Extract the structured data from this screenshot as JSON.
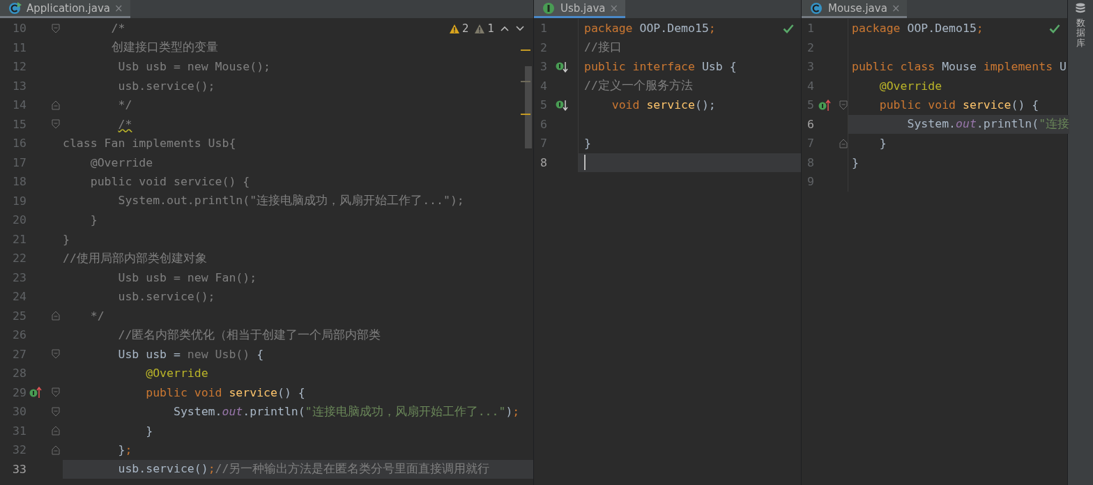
{
  "panes": [
    {
      "tab": {
        "label": "Application.java",
        "kind": "class",
        "runnable": true,
        "close": "×"
      },
      "focused": false,
      "inspections": {
        "warnings": "2",
        "weak_warnings": "1"
      },
      "lines": [
        {
          "number": "10",
          "current": false,
          "fold": {
            "kind": "start"
          },
          "tokens": [
            {
              "text": "       /*",
              "kind": "comment"
            }
          ]
        },
        {
          "number": "11",
          "current": false,
          "tokens": [
            {
              "text": "       创建接口类型的变量",
              "kind": "comment"
            }
          ]
        },
        {
          "number": "12",
          "current": false,
          "tokens": [
            {
              "text": "        Usb usb = new Mouse();",
              "kind": "comment"
            }
          ]
        },
        {
          "number": "13",
          "current": false,
          "tokens": [
            {
              "text": "        usb.service();",
              "kind": "comment"
            }
          ]
        },
        {
          "number": "14",
          "current": false,
          "fold": {
            "kind": "end"
          },
          "tokens": [
            {
              "text": "        */",
              "kind": "comment"
            }
          ]
        },
        {
          "number": "15",
          "current": false,
          "fold": {
            "kind": "start"
          },
          "tokens": [
            {
              "text": "        /*",
              "kind": "flagged"
            }
          ]
        },
        {
          "number": "16",
          "current": false,
          "tokens": [
            {
              "text": "class Fan implements Usb{",
              "kind": "comment"
            }
          ]
        },
        {
          "number": "17",
          "current": false,
          "tokens": [
            {
              "text": "    @Override",
              "kind": "comment"
            }
          ]
        },
        {
          "number": "18",
          "current": false,
          "tokens": [
            {
              "text": "    public void service() {",
              "kind": "comment"
            }
          ]
        },
        {
          "number": "19",
          "current": false,
          "tokens": [
            {
              "text": "        System.out.println(\"连接电脑成功，风扇开始工作了...\");",
              "kind": "comment"
            }
          ]
        },
        {
          "number": "20",
          "current": false,
          "tokens": [
            {
              "text": "    }",
              "kind": "comment"
            }
          ]
        },
        {
          "number": "21",
          "current": false,
          "tokens": [
            {
              "text": "}",
              "kind": "comment"
            }
          ]
        },
        {
          "number": "22",
          "current": false,
          "tokens": [
            {
              "text": "//使用局部内部类创建对象",
              "kind": "comment"
            }
          ]
        },
        {
          "number": "23",
          "current": false,
          "tokens": [
            {
              "text": "        Usb usb = new Fan();",
              "kind": "comment"
            }
          ]
        },
        {
          "number": "24",
          "current": false,
          "tokens": [
            {
              "text": "        usb.service();",
              "kind": "comment"
            }
          ]
        },
        {
          "number": "25",
          "current": false,
          "fold": {
            "kind": "end"
          },
          "tokens": [
            {
              "text": "    */",
              "kind": "comment"
            }
          ]
        },
        {
          "number": "26",
          "current": false,
          "tokens": [
            {
              "text": "        //匿名内部类优化（相当于创建了一个局部内部类",
              "kind": "comment"
            }
          ]
        },
        {
          "number": "27",
          "current": false,
          "fold": {
            "kind": "start"
          },
          "tokens": [
            {
              "text": "        Usb usb = ",
              "kind": "plain"
            },
            {
              "text": "new Usb()",
              "kind": "unused"
            },
            {
              "text": " {",
              "kind": "plain"
            }
          ]
        },
        {
          "number": "28",
          "current": false,
          "tokens": [
            {
              "text": "            @Override",
              "kind": "annotation"
            }
          ]
        },
        {
          "number": "29",
          "current": false,
          "fold": {
            "kind": "start"
          },
          "marker": {
            "kind": "overrides"
          },
          "tokens": [
            {
              "text": "            public void ",
              "kind": "keyword"
            },
            {
              "text": "service",
              "kind": "method"
            },
            {
              "text": "() {",
              "kind": "plain"
            }
          ]
        },
        {
          "number": "30",
          "current": false,
          "fold": {
            "kind": "start"
          },
          "tokens": [
            {
              "text": "                System.",
              "kind": "plain"
            },
            {
              "text": "out",
              "kind": "static"
            },
            {
              "text": ".println(",
              "kind": "plain"
            },
            {
              "text": "\"连接电脑成功，风扇开始工作了...\"",
              "kind": "string"
            },
            {
              "text": ")",
              "kind": "plain"
            },
            {
              "text": ";",
              "kind": "keyword"
            }
          ]
        },
        {
          "number": "31",
          "current": false,
          "fold": {
            "kind": "end"
          },
          "tokens": [
            {
              "text": "            }",
              "kind": "plain"
            }
          ]
        },
        {
          "number": "32",
          "current": false,
          "fold": {
            "kind": "end"
          },
          "tokens": [
            {
              "text": "        }",
              "kind": "plain"
            },
            {
              "text": ";",
              "kind": "keyword"
            }
          ]
        },
        {
          "number": "33",
          "current": true,
          "tokens": [
            {
              "text": "        usb.service()",
              "kind": "plain"
            },
            {
              "text": ";",
              "kind": "keyword"
            },
            {
              "text": "//另一种输出方法是在匿名类分号里面直接调用就行",
              "kind": "comment"
            }
          ]
        }
      ]
    },
    {
      "tab": {
        "label": "Usb.java",
        "kind": "interface",
        "runnable": false,
        "close": "×"
      },
      "focused": true,
      "check": true,
      "lines": [
        {
          "number": "1",
          "current": false,
          "tokens": [
            {
              "text": "package",
              "kind": "keyword"
            },
            {
              "text": " OOP.Demo15",
              "kind": "plain"
            },
            {
              "text": ";",
              "kind": "keyword"
            }
          ]
        },
        {
          "number": "2",
          "current": false,
          "tokens": [
            {
              "text": "//接口",
              "kind": "comment"
            }
          ]
        },
        {
          "number": "3",
          "current": false,
          "marker": {
            "kind": "implemented"
          },
          "tokens": [
            {
              "text": "public interface ",
              "kind": "keyword"
            },
            {
              "text": "Usb {",
              "kind": "plain"
            }
          ]
        },
        {
          "number": "4",
          "current": false,
          "tokens": [
            {
              "text": "//定义一个服务方法",
              "kind": "comment"
            }
          ]
        },
        {
          "number": "5",
          "current": false,
          "marker": {
            "kind": "implemented"
          },
          "tokens": [
            {
              "text": "    void ",
              "kind": "keyword"
            },
            {
              "text": "service",
              "kind": "method"
            },
            {
              "text": "();",
              "kind": "plain"
            }
          ]
        },
        {
          "number": "6",
          "current": false
        },
        {
          "number": "7",
          "current": false,
          "tokens": [
            {
              "text": "}",
              "kind": "plain"
            }
          ]
        },
        {
          "number": "8",
          "current": true
        }
      ]
    },
    {
      "tab": {
        "label": "Mouse.java",
        "kind": "class",
        "runnable": false,
        "close": "×"
      },
      "focused": false,
      "check": true,
      "lines": [
        {
          "number": "1",
          "current": false,
          "tokens": [
            {
              "text": "package",
              "kind": "keyword"
            },
            {
              "text": " OOP.Demo15",
              "kind": "plain"
            },
            {
              "text": ";",
              "kind": "keyword"
            }
          ]
        },
        {
          "number": "2",
          "current": false
        },
        {
          "number": "3",
          "current": false,
          "tokens": [
            {
              "text": "public class ",
              "kind": "keyword"
            },
            {
              "text": "Mouse ",
              "kind": "plain"
            },
            {
              "text": "implements ",
              "kind": "keyword"
            },
            {
              "text": "U",
              "kind": "plain"
            }
          ]
        },
        {
          "number": "4",
          "current": false,
          "tokens": [
            {
              "text": "    @Override",
              "kind": "annotation"
            }
          ]
        },
        {
          "number": "5",
          "current": false,
          "fold": {
            "kind": "start"
          },
          "marker": {
            "kind": "overrides"
          },
          "tokens": [
            {
              "text": "    public void ",
              "kind": "keyword"
            },
            {
              "text": "service",
              "kind": "method"
            },
            {
              "text": "() {",
              "kind": "plain"
            }
          ]
        },
        {
          "number": "6",
          "current": true,
          "tokens": [
            {
              "text": "        System.",
              "kind": "plain"
            },
            {
              "text": "out",
              "kind": "static"
            },
            {
              "text": ".println(",
              "kind": "plain"
            },
            {
              "text": "\"连接",
              "kind": "string"
            }
          ]
        },
        {
          "number": "7",
          "current": false,
          "fold": {
            "kind": "end"
          },
          "tokens": [
            {
              "text": "    }",
              "kind": "plain"
            }
          ]
        },
        {
          "number": "8",
          "current": false,
          "tokens": [
            {
              "text": "}",
              "kind": "plain"
            }
          ]
        },
        {
          "number": "9",
          "current": false
        }
      ]
    }
  ],
  "sidebar": {
    "label": "数据库"
  }
}
